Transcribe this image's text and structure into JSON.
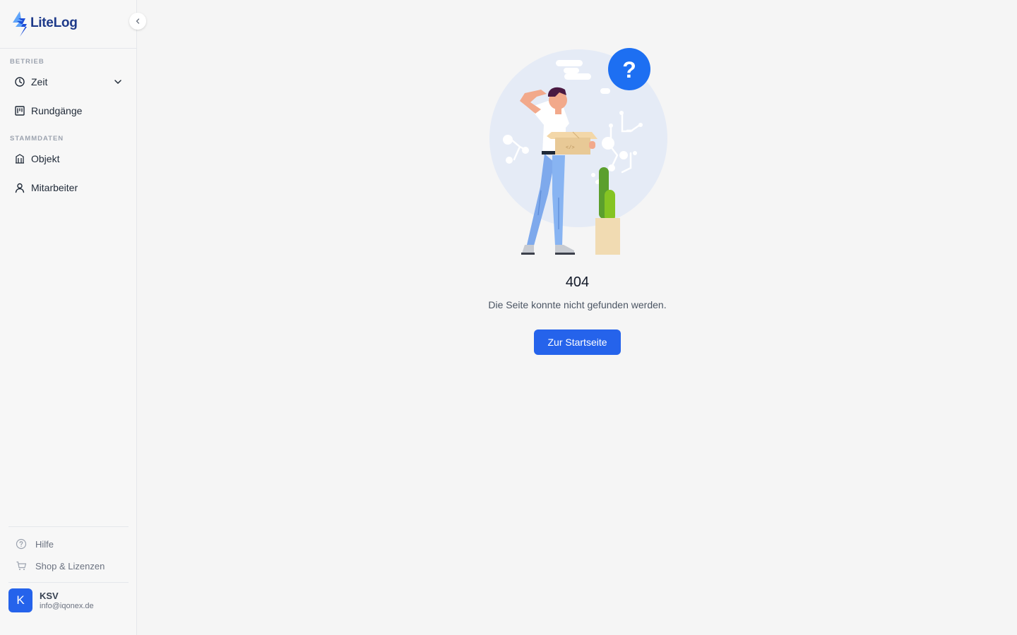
{
  "app": {
    "name": "LiteLog"
  },
  "sidebar": {
    "sections": [
      {
        "label": "BETRIEB"
      },
      {
        "label": "STAMMDATEN"
      }
    ],
    "items": [
      {
        "label": "Zeit",
        "icon": "clock-icon",
        "expandable": true
      },
      {
        "label": "Rundgänge",
        "icon": "route-icon"
      },
      {
        "label": "Objekt",
        "icon": "building-icon"
      },
      {
        "label": "Mitarbeiter",
        "icon": "user-icon"
      }
    ],
    "bottom": [
      {
        "label": "Hilfe",
        "icon": "help-circle-icon"
      },
      {
        "label": "Shop & Lizenzen",
        "icon": "cart-icon"
      }
    ],
    "user": {
      "initial": "K",
      "name": "KSV",
      "email": "info@iqonex.de"
    }
  },
  "main": {
    "error_code": "404",
    "message": "Die Seite konnte nicht gefunden werden.",
    "button_label": "Zur Startseite"
  },
  "colors": {
    "accent": "#2563eb",
    "brand_dark": "#1e3a8a",
    "background": "#f5f5f5"
  }
}
